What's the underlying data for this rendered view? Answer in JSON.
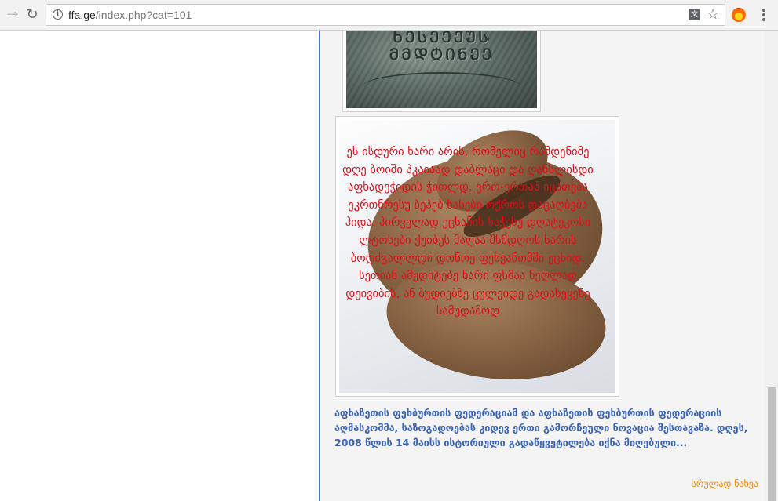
{
  "browser": {
    "url_host": "ffa.ge",
    "url_path": "/index.php?cat=101",
    "icons": {
      "back": "arrow-left-icon",
      "reload": "reload-icon",
      "info": "info-icon",
      "translate": "translate-icon",
      "bookmark": "star-icon",
      "extension": "fire-extension-icon",
      "menu": "kebab-menu-icon"
    },
    "glyphs": {
      "back": "→",
      "reload": "↻",
      "info": "i",
      "translate": "文",
      "star": "☆"
    }
  },
  "article": {
    "medal_engraving": [
      "ᲮᲔᲡᲔᲔᲔᲣᲡ",
      "ᲛᲛᲓᲢᲘᲜᲔᲔ"
    ],
    "photo_caption": "ეს ისდური ხარი არის, რომელიც რამდენიმე დღე ბოიში პკაიაად დაბლაცი და ღანსლისდი აფხადეჭიდის ჭითლდ, ერთ-ერთან იცათება ეკრთნრესუ ბეპებ ხახები ოქროს დაცაღბება ჰიდა. პირველად ეცხანის საჭესუ დღატეკოსი ლტოსები ქუიბეს მაღაა შსმდღოს ხარის ბოდძგალლდი დონოე ფეხვანთმში ეცხიდ. სეთიან ამჟდიტებე ხარი ფსმაა ნეღლად დეივიბის, ან ბუდიებზე ცულეიდე გადასეყენე სამუდამოდ",
    "summary": "აფხაზეთის ფეხბურთის ფედერაციამ და აფხაზეთის ფეხბურთის ფედერაციის აღმასკომმა, საზოგადოებას კიდევ ერთი გამორჩეული ნოვაცია შესთავაზა. დღეს, 2008 წლის 14 მაისს ისტორიული გადაწყვეტილება იქნა მიღებული...",
    "read_more": "სრულად ნახვა"
  },
  "colors": {
    "accent_border": "#3a7bd5",
    "overlay_text": "#e00d18",
    "summary_text": "#3a63b8",
    "read_more": "#f08a00"
  }
}
